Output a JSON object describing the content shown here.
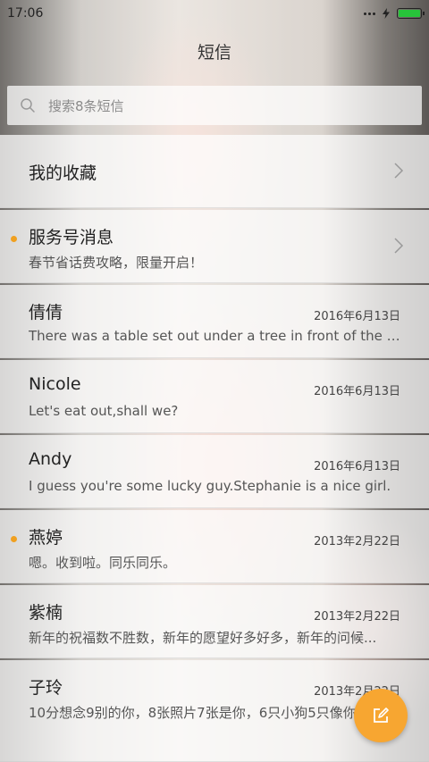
{
  "status": {
    "time": "17:06"
  },
  "header": {
    "title": "短信"
  },
  "search": {
    "placeholder": "搜索8条短信"
  },
  "conversations": [
    {
      "name": "我的收藏",
      "preview": "",
      "date": "",
      "unread": false,
      "chevron": true
    },
    {
      "name": "服务号消息",
      "preview": "春节省话费攻略，限量开启！",
      "date": "",
      "unread": true,
      "chevron": true
    },
    {
      "name": "倩倩",
      "preview": "There was a table set out under a tree in front of the ho...",
      "date": "2016年6月13日",
      "unread": false,
      "chevron": false
    },
    {
      "name": "Nicole",
      "preview": "Let's eat out,shall we?",
      "date": "2016年6月13日",
      "unread": false,
      "chevron": false
    },
    {
      "name": "Andy",
      "preview": "I guess you're some lucky guy.Stephanie is a nice girl.",
      "date": "2016年6月13日",
      "unread": false,
      "chevron": false
    },
    {
      "name": "燕婷",
      "preview": "嗯。收到啦。同乐同乐。",
      "date": "2013年2月22日",
      "unread": true,
      "chevron": false
    },
    {
      "name": "紫楠",
      "preview": "新年的祝福数不胜数，新年的愿望好多好多，新年的问候...",
      "date": "2013年2月22日",
      "unread": false,
      "chevron": false
    },
    {
      "name": "子玲",
      "preview": "10分想念9别的你，8张照片7张是你，6只小狗5只像你",
      "date": "2013年2月22日",
      "unread": false,
      "chevron": false
    }
  ],
  "colors": {
    "accent": "#f7a631",
    "unread_dot": "#f0a020",
    "battery": "#27c43a"
  },
  "icons": {
    "search": "search-icon",
    "compose": "compose-icon",
    "chevron": "chevron-right-icon"
  }
}
